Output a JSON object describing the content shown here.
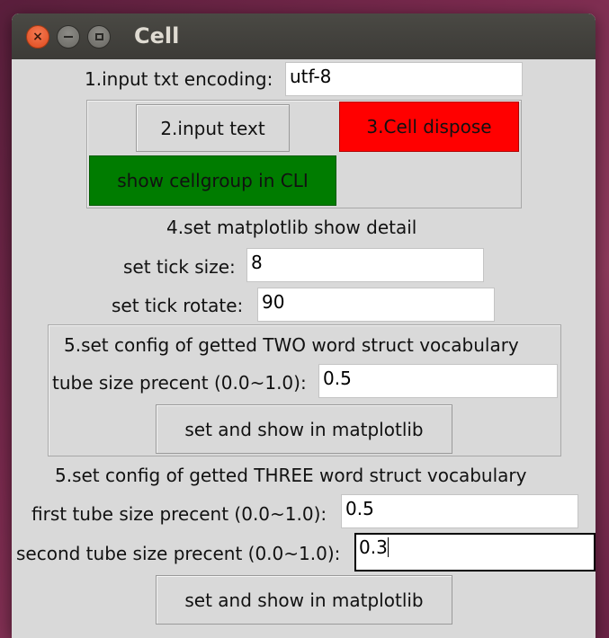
{
  "window": {
    "title": "Cell",
    "close_glyph": "×"
  },
  "encoding": {
    "label": "1.input txt encoding:",
    "value": "utf-8"
  },
  "actions": {
    "input_text_label": "2.input text",
    "cell_dispose_label": "3.Cell dispose",
    "cell_dispose_color": "#ff0000",
    "show_cellgroup_label": "show cellgroup in CLI",
    "show_cellgroup_color": "#007c00"
  },
  "matplotlib": {
    "heading": "4.set matplotlib show detail",
    "tick_size_label": "set tick size:",
    "tick_size_value": "8",
    "tick_rotate_label": "set tick rotate:",
    "tick_rotate_value": "90"
  },
  "two_word": {
    "heading": "5.set config of getted TWO word struct vocabulary",
    "tube_label": "tube size precent (0.0~1.0):",
    "tube_value": "0.5",
    "button_label": "set and show in matplotlib"
  },
  "three_word": {
    "heading": "5.set config of getted THREE word struct vocabulary",
    "first_label": "first tube size precent (0.0~1.0):",
    "first_value": "0.5",
    "second_label": "second tube size precent (0.0~1.0):",
    "second_value": "0.3",
    "button_label": "set and show in matplotlib"
  }
}
